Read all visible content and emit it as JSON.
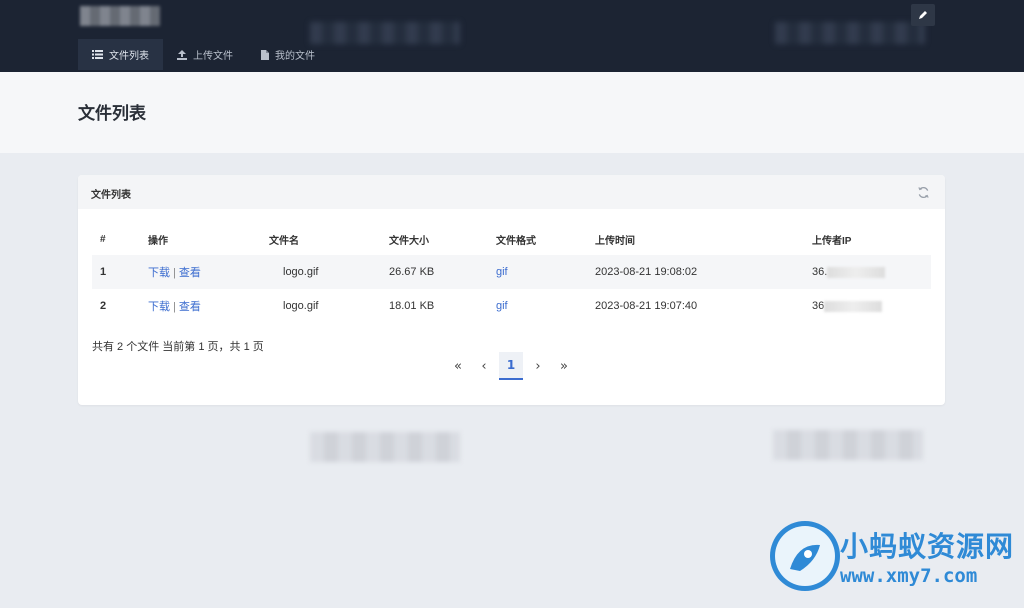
{
  "nav": {
    "items": [
      {
        "label": "文件列表",
        "icon": "list-icon",
        "active": true
      },
      {
        "label": "上传文件",
        "icon": "upload-icon",
        "active": false
      },
      {
        "label": "我的文件",
        "icon": "file-icon",
        "active": false
      }
    ]
  },
  "page": {
    "title": "文件列表"
  },
  "card": {
    "title": "文件列表",
    "table": {
      "headers": [
        "#",
        "操作",
        "文件名",
        "文件大小",
        "文件格式",
        "上传时间",
        "上传者IP"
      ],
      "rows": [
        {
          "index": "1",
          "download": "下载",
          "view": "查看",
          "name": "logo.gif",
          "size": "26.67 KB",
          "format": "gif",
          "time": "2023-08-21 19:08:02",
          "ip": "36."
        },
        {
          "index": "2",
          "download": "下载",
          "view": "查看",
          "name": "logo.gif",
          "size": "18.01 KB",
          "format": "gif",
          "time": "2023-08-21 19:07:40",
          "ip": "36"
        }
      ]
    },
    "summary": "共有 2 个文件  当前第 1 页，共 1 页",
    "pagination": {
      "first": "«",
      "prev": "‹",
      "current": "1",
      "next": "›",
      "last": "»"
    }
  },
  "watermark": {
    "name": "小蚂蚁资源网",
    "url": "www.xmy7.com"
  },
  "colors": {
    "header_bg": "#1c2433",
    "accent": "#3b6ccf",
    "brand": "#2f8ad6"
  }
}
